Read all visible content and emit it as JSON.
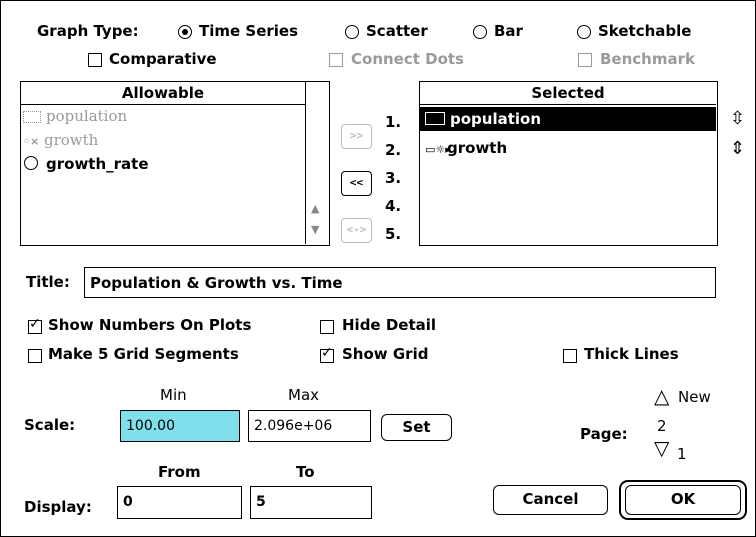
{
  "graph_type": {
    "label": "Graph Type:",
    "options": [
      "Time Series",
      "Scatter",
      "Bar",
      "Sketchable"
    ],
    "selected": "Time Series"
  },
  "options_row1": {
    "comparative": "Comparative",
    "connect_dots": "Connect Dots",
    "benchmark": "Benchmark"
  },
  "allowable": {
    "header": "Allowable",
    "items": [
      "population",
      "growth",
      "growth_rate"
    ]
  },
  "selected": {
    "header": "Selected",
    "numbers": [
      "1.",
      "2.",
      "3.",
      "4.",
      "5."
    ],
    "items": [
      "population",
      "growth"
    ]
  },
  "move_buttons": {
    "add": ">>",
    "remove": "<<",
    "swap": "<->"
  },
  "title": {
    "label": "Title:",
    "value": "Population & Growth vs. Time"
  },
  "checkboxes": {
    "show_numbers": "Show Numbers On Plots",
    "hide_detail": "Hide Detail",
    "grid_segments": "Make 5 Grid Segments",
    "show_grid": "Show Grid",
    "thick_lines": "Thick Lines"
  },
  "scale": {
    "label": "Scale:",
    "min_label": "Min",
    "max_label": "Max",
    "min": "100.00",
    "max": "2.096e+06",
    "set": "Set"
  },
  "display": {
    "label": "Display:",
    "from_label": "From",
    "to_label": "To",
    "from": "0",
    "to": "5"
  },
  "page": {
    "label": "Page:",
    "value": "2",
    "new": "New",
    "prev": "1"
  },
  "buttons": {
    "cancel": "Cancel",
    "ok": "OK"
  },
  "colors": {
    "scale_min_highlight": "#7fdfea",
    "selected_row": "#000000"
  }
}
